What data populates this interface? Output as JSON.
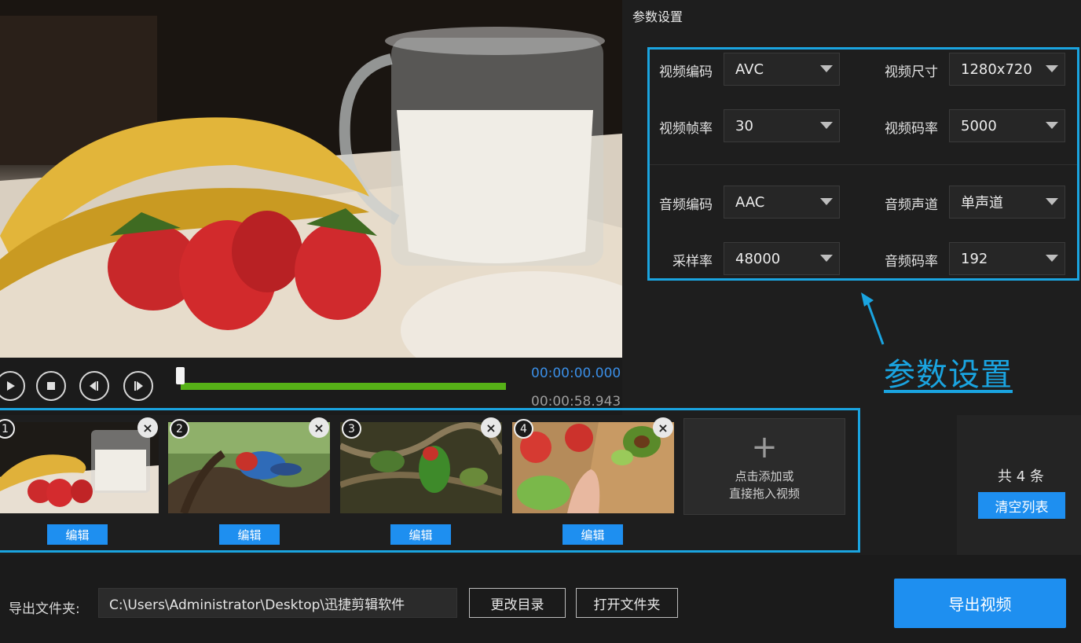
{
  "player": {
    "time_current": "00:00:00.000",
    "time_total": "00:00:58.943",
    "progress": 0.0
  },
  "params": {
    "title": "参数设置",
    "video_codec": {
      "label": "视频编码",
      "value": "AVC"
    },
    "video_size": {
      "label": "视频尺寸",
      "value": "1280x720"
    },
    "video_fps": {
      "label": "视频帧率",
      "value": "30"
    },
    "video_bitrate": {
      "label": "视频码率",
      "value": "5000"
    },
    "audio_codec": {
      "label": "音频编码",
      "value": "AAC"
    },
    "audio_channel": {
      "label": "音频声道",
      "value": "单声道"
    },
    "sample_rate": {
      "label": "采样率",
      "value": "48000"
    },
    "audio_bitrate": {
      "label": "音频码率",
      "value": "192"
    },
    "annotation": "参数设置"
  },
  "clips": {
    "items": [
      {
        "num": "1",
        "edit_label": "编辑",
        "close": "×"
      },
      {
        "num": "2",
        "edit_label": "编辑",
        "close": "×"
      },
      {
        "num": "3",
        "edit_label": "编辑",
        "close": "×"
      },
      {
        "num": "4",
        "edit_label": "编辑",
        "close": "×"
      }
    ],
    "add_plus": "+",
    "add_line1": "点击添加或",
    "add_line2": "直接拖入视频",
    "count_text": "共 4 条",
    "clear_label": "清空列表"
  },
  "export": {
    "folder_label": "导出文件夹:",
    "path": "C:\\Users\\Administrator\\Desktop\\迅捷剪辑软件",
    "change_dir_label": "更改目录",
    "open_folder_label": "打开文件夹",
    "export_label": "导出视频"
  },
  "colors": {
    "accent": "#1e8ff0",
    "highlight_box": "#1aa4e0",
    "progress": "#56b117",
    "time_current": "#3a8ee6"
  }
}
